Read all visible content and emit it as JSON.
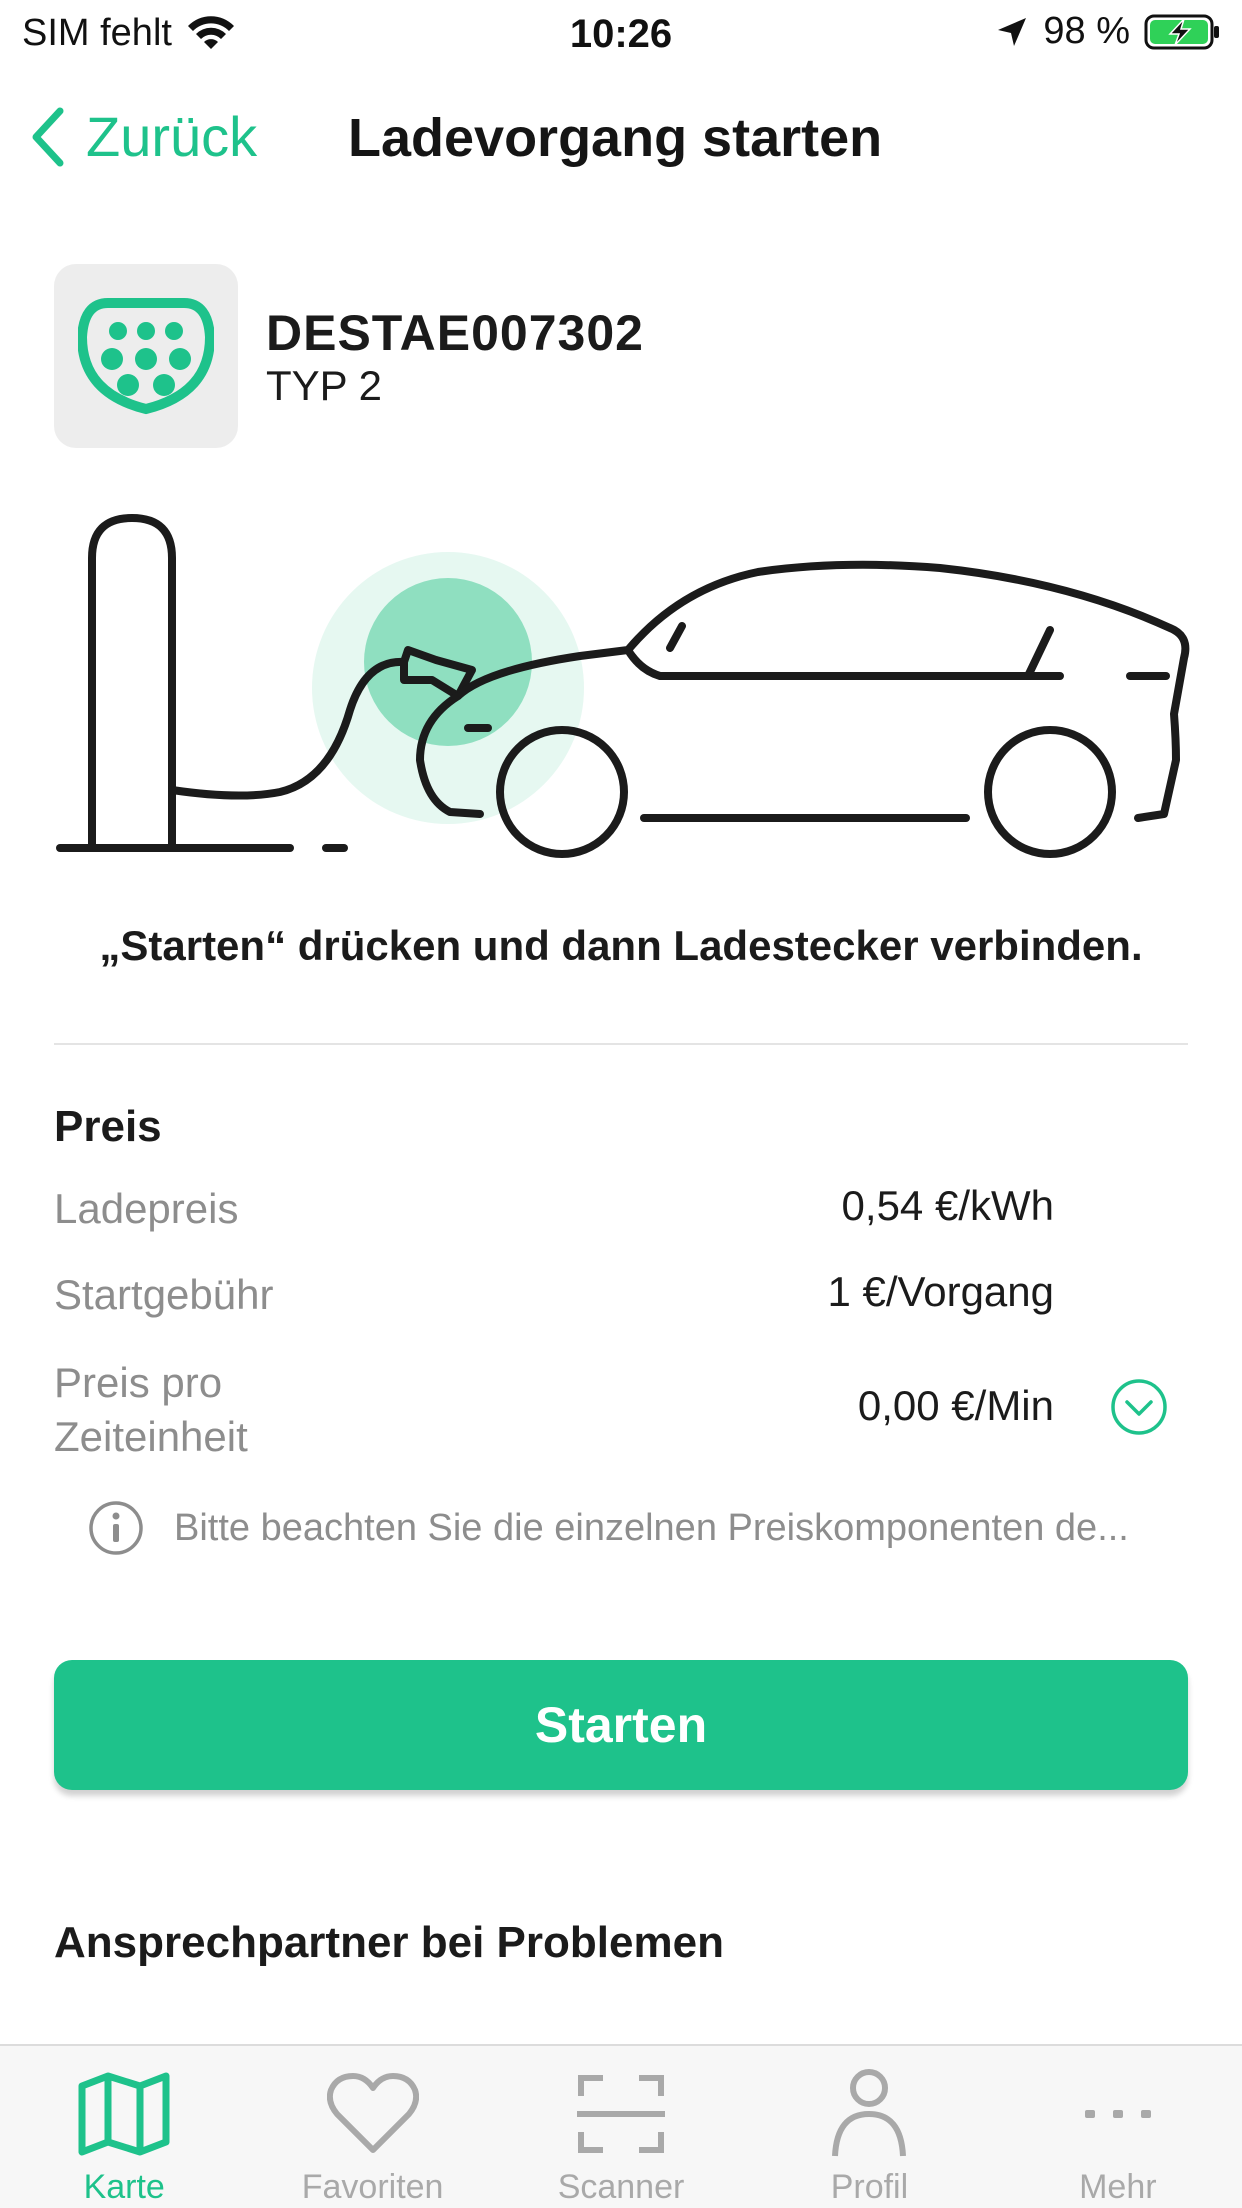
{
  "status_bar": {
    "carrier": "SIM fehlt",
    "time": "10:26",
    "battery": "98 %"
  },
  "nav": {
    "back_label": "Zurück",
    "title": "Ladevorgang starten"
  },
  "station": {
    "id": "DESTAE007302",
    "type": "TYP 2",
    "connector_icon": "type2-connector-icon"
  },
  "instruction": "„Starten“ drücken und dann Ladestecker verbinden.",
  "price": {
    "heading": "Preis",
    "rows": [
      {
        "label": "Ladepreis",
        "value": "0,54 €/kWh"
      },
      {
        "label": "Startgebühr",
        "value": "1 €/Vorgang"
      },
      {
        "label_line1": "Preis pro",
        "label_line2": "Zeiteinheit",
        "value": "0,00 €/Min"
      }
    ],
    "info_text": "Bitte beachten Sie die einzelnen Preiskomponenten de..."
  },
  "start_button_label": "Starten",
  "contact_heading": "Ansprechpartner bei Problemen",
  "tabs": [
    {
      "label": "Karte",
      "icon": "map-icon",
      "active": true
    },
    {
      "label": "Favoriten",
      "icon": "heart-icon",
      "active": false
    },
    {
      "label": "Scanner",
      "icon": "scanner-icon",
      "active": false
    },
    {
      "label": "Profil",
      "icon": "profile-icon",
      "active": false
    },
    {
      "label": "Mehr",
      "icon": "more-icon",
      "active": false
    }
  ],
  "colors": {
    "accent": "#1ec28b",
    "accent_light": "#e6f8f1",
    "accent_mid": "#8fdfc0",
    "muted_text": "#8d8d8d"
  }
}
